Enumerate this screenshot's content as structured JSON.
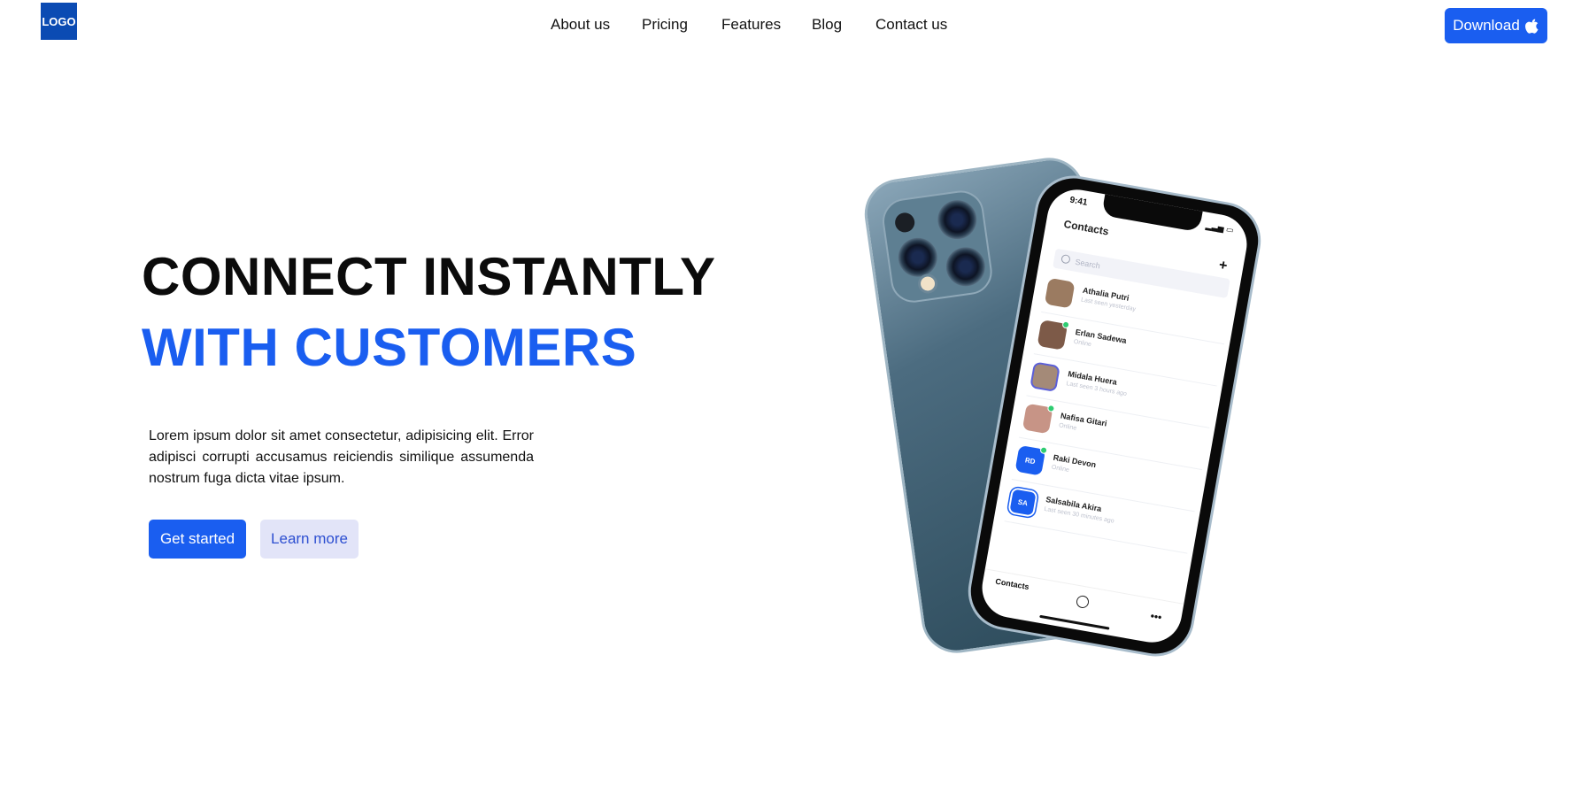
{
  "header": {
    "logo": "LOGO",
    "nav": [
      "About us",
      "Pricing",
      "Features",
      "Blog",
      "Contact us"
    ],
    "download_label": "Download"
  },
  "hero": {
    "line1": "CONNECT INSTANTLY",
    "line2": "WITH CUSTOMERS",
    "description": "Lorem ipsum dolor sit amet consectetur, adipisicing elit. Error adipisci corrupti accusamus reiciendis similique assumenda nostrum fuga dicta vitae ipsum.",
    "primary_button": "Get started",
    "secondary_button": "Learn more"
  },
  "phone": {
    "time": "9:41",
    "title": "Contacts",
    "search_placeholder": "Search",
    "contacts": [
      {
        "name": "Athalia Putri",
        "status": "Last seen yesterday"
      },
      {
        "name": "Erlan Sadewa",
        "status": "Online"
      },
      {
        "name": "Midala Huera",
        "status": "Last seen 3 hours ago"
      },
      {
        "name": "Nafisa Gitari",
        "status": "Online"
      },
      {
        "name": "Raki Devon",
        "status": "Online",
        "initials": "RD"
      },
      {
        "name": "Salsabila Akira",
        "status": "Last seen 30 minutes ago",
        "initials": "SA"
      }
    ],
    "tab_label": "Contacts"
  },
  "colors": {
    "brand_blue": "#1a5ef0",
    "logo_blue": "#0b4bb3",
    "learn_more_bg": "#e2e4f8"
  },
  "icons": [
    "apple-icon",
    "search-icon",
    "plus-icon",
    "chat-icon",
    "more-icon"
  ]
}
